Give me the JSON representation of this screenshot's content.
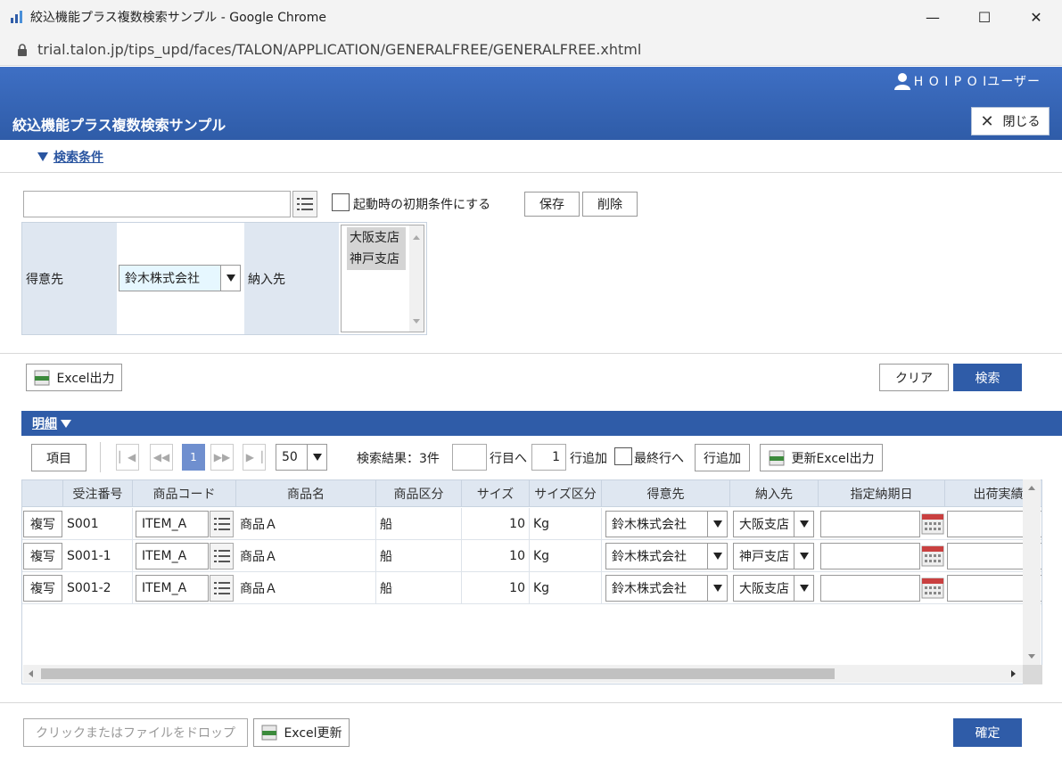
{
  "window": {
    "title": "絞込機能プラス複数検索サンプル - Google Chrome",
    "url": "trial.talon.jp/tips_upd/faces/TALON/APPLICATION/GENERALFREE/GENERALFREE.xhtml",
    "minimize": "—",
    "maximize": "☐",
    "close": "✕"
  },
  "header": {
    "user": "H O I P O Iユーザー",
    "page_title": "絞込機能プラス複数検索サンプル",
    "close_label": "閉じる"
  },
  "search": {
    "section_label": "検索条件",
    "condition_value": "",
    "startup_checkbox_label": "起動時の初期条件にする",
    "save_label": "保存",
    "delete_label": "削除",
    "customer_label": "得意先",
    "customer_value": "鈴木株式会社",
    "delivery_label": "納入先",
    "delivery_options": [
      "大阪支店",
      "神戸支店"
    ],
    "excel_output_label": "Excel出力",
    "clear_label": "クリア",
    "search_label": "検索"
  },
  "detail": {
    "section_label": "明細",
    "items_label": "項目",
    "page_current": "1",
    "page_size": "50",
    "result_text": "検索結果：3件",
    "goto_row_value": "",
    "goto_row_label": "行目へ",
    "add_count_value": "1",
    "add_count_label": "行追加",
    "last_row_label": "最終行へ",
    "add_row_label": "行追加",
    "update_excel_label": "更新Excel出力",
    "columns": [
      "受注番号",
      "商品コード",
      "商品名",
      "商品区分",
      "サイズ",
      "サイズ区分",
      "得意先",
      "納入先",
      "指定納期日",
      "出荷実績"
    ],
    "copy_label": "複写",
    "rows": [
      {
        "order_no": "S001",
        "item_code": "ITEM_A",
        "item_name": "商品Ａ",
        "item_type": "船",
        "size": "10",
        "size_unit": "Kg",
        "customer": "鈴木株式会社",
        "delivery": "大阪支店",
        "due_date": "",
        "shipped": ""
      },
      {
        "order_no": "S001-1",
        "item_code": "ITEM_A",
        "item_name": "商品Ａ",
        "item_type": "船",
        "size": "10",
        "size_unit": "Kg",
        "customer": "鈴木株式会社",
        "delivery": "神戸支店",
        "due_date": "",
        "shipped": ""
      },
      {
        "order_no": "S001-2",
        "item_code": "ITEM_A",
        "item_name": "商品Ａ",
        "item_type": "船",
        "size": "10",
        "size_unit": "Kg",
        "customer": "鈴木株式会社",
        "delivery": "大阪支店",
        "due_date": "",
        "shipped": ""
      }
    ]
  },
  "footer": {
    "dropzone_label": "クリックまたはファイルをドロップ",
    "excel_update_label": "Excel更新",
    "confirm_label": "確定"
  }
}
